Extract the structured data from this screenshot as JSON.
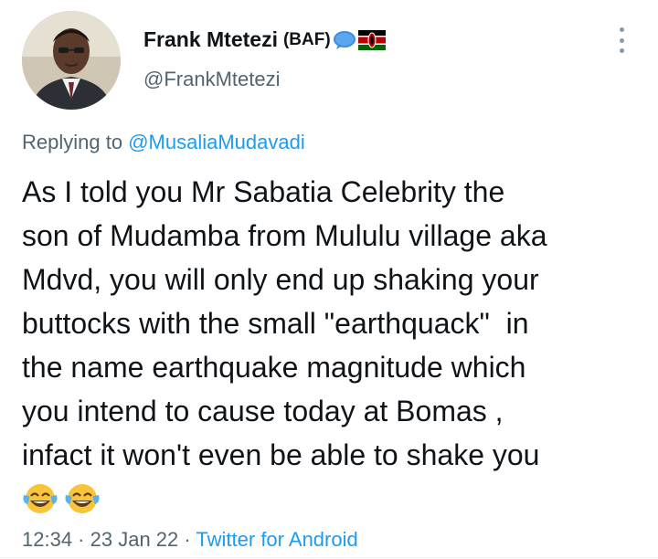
{
  "author": {
    "display_name": "Frank Mtetezi",
    "badge": "(BAF)",
    "handle": "@FrankMtetezi"
  },
  "icons": {
    "avatar": "avatar-photo",
    "emoji_1": "speech-balloon-icon",
    "emoji_2": "kenya-flag-icon",
    "more": "more-options-icon",
    "tears_of_joy": "face-with-tears-of-joy-icon"
  },
  "reply": {
    "prefix": "Replying to",
    "mention": "@MusaliaMudavadi"
  },
  "tweet": {
    "lines": [
      "As I told you Mr Sabatia Celebrity the",
      "son of Mudamba from Mululu village aka",
      "Mdvd, you will only end up shaking your",
      "buttocks with the small \"earthquack\"  in",
      "the name earthquake magnitude which",
      "you intend to cause today at Bomas ,",
      "infact it won't even be able to shake you"
    ]
  },
  "meta": {
    "time": "12:34",
    "sep1": " · ",
    "date": "23 Jan 22",
    "sep2": " · ",
    "source": "Twitter for Android"
  },
  "colors": {
    "link": "#1d9bf0",
    "secondary_text": "#536471",
    "primary_text": "#0f1419"
  }
}
